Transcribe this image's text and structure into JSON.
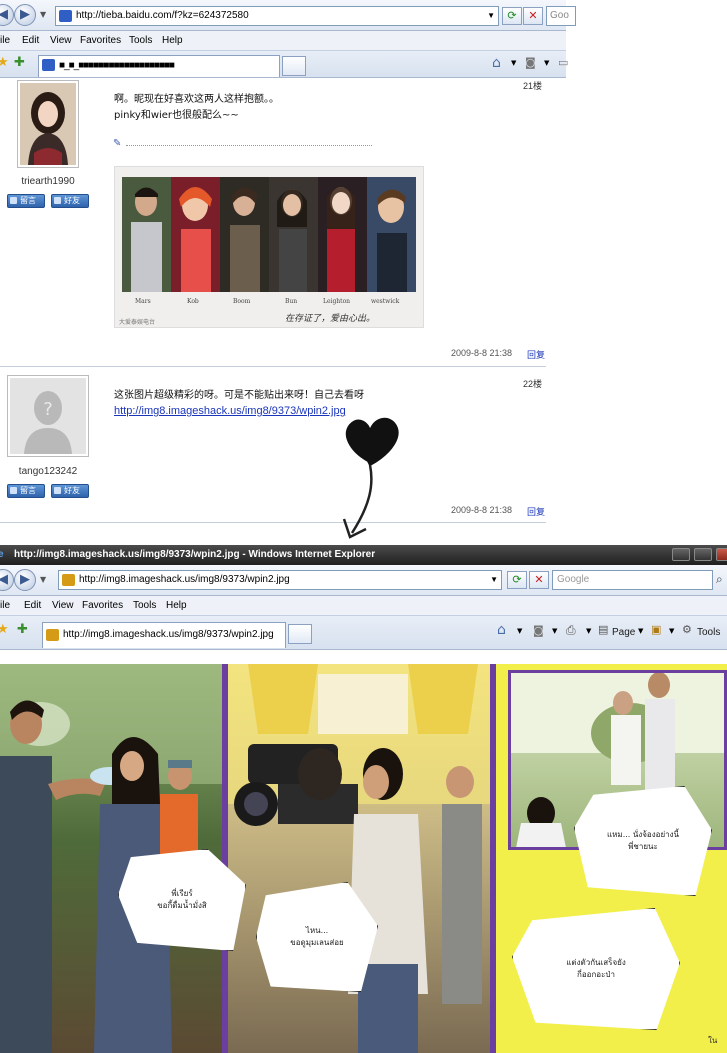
{
  "browser1": {
    "address": "http://tieba.baidu.com/f?kz=624372580",
    "search_placeholder": "Goo",
    "menu": [
      "ile",
      "Edit",
      "View",
      "Favorites",
      "Tools",
      "Help"
    ],
    "tab_title": "■_■_■■■■■■■■■■■■■■■■■■■"
  },
  "post21": {
    "floor": "21楼",
    "username": "triearth1990",
    "buttons": [
      "留言",
      "好友"
    ],
    "line1": "啊。昵现在好喜欢这两人这样抱额。。",
    "line2": "pinky和wier也很般配么~~",
    "image_names": [
      "Mars",
      "Kob",
      "Boom",
      "Bun",
      "Leighton",
      "westwick"
    ],
    "image_caption_left": "大爱泰娱电台",
    "image_caption_right": "在存证了，爱由心出。",
    "date": "2009-8-8 21:38",
    "reply": "回复"
  },
  "post22": {
    "floor": "22楼",
    "username": "tango123242",
    "buttons": [
      "留言",
      "好友"
    ],
    "line1": "这张图片超级精彩的呀。可是不能贴出来呀！自己去看呀",
    "link": "http://img8.imageshack.us/img8/9373/wpin2.jpg",
    "date": "2009-8-8 21:38",
    "reply": "回复"
  },
  "browser2": {
    "title": "http://img8.imageshack.us/img8/9373/wpin2.jpg - Windows Internet Explorer",
    "address": "http://img8.imageshack.us/img8/9373/wpin2.jpg",
    "search_placeholder": "Google",
    "menu": [
      "ile",
      "Edit",
      "View",
      "Favorites",
      "Tools",
      "Help"
    ],
    "tab_title": "http://img8.imageshack.us/img8/9373/wpin2.jpg",
    "commands": [
      "Page",
      "Tools"
    ]
  },
  "comic": {
    "bubbles": [
      "พี่เรียร์\nขอกี้ดื่มน้ำมั่งสิ",
      "ไหน...\nขอดูมุมเลนส่อย",
      "แหม... นั่งจ้องอย่างนี้\nพี่ชายนะ",
      "แต่งตัวกันเสร็จยัง\nกี่ออกอะป่า"
    ],
    "page_mark": "ใน"
  },
  "colors": {
    "link": "#1a35b8",
    "comic_yellow": "#f2ef4a",
    "comic_purple": "#6b3fa0",
    "titlebar": "#2a2a2a"
  }
}
